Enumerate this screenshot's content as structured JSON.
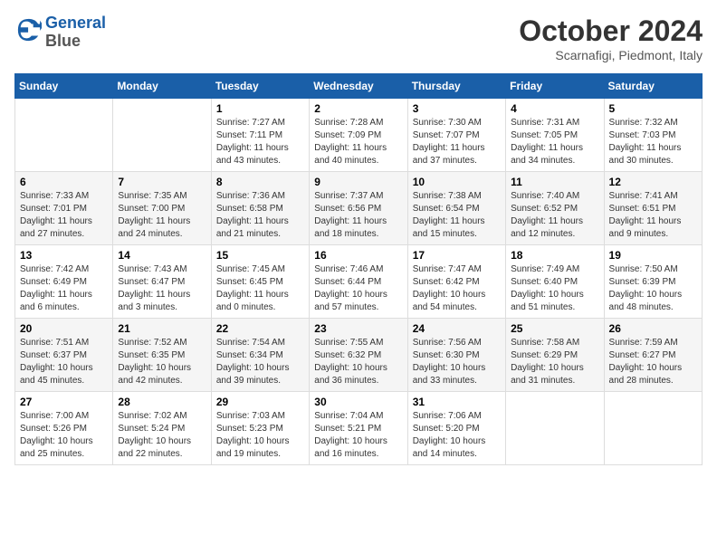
{
  "header": {
    "logo_line1": "General",
    "logo_line2": "Blue",
    "month": "October 2024",
    "location": "Scarnafigi, Piedmont, Italy"
  },
  "days_of_week": [
    "Sunday",
    "Monday",
    "Tuesday",
    "Wednesday",
    "Thursday",
    "Friday",
    "Saturday"
  ],
  "weeks": [
    [
      {
        "day": "",
        "sunrise": "",
        "sunset": "",
        "daylight": ""
      },
      {
        "day": "",
        "sunrise": "",
        "sunset": "",
        "daylight": ""
      },
      {
        "day": "1",
        "sunrise": "Sunrise: 7:27 AM",
        "sunset": "Sunset: 7:11 PM",
        "daylight": "Daylight: 11 hours and 43 minutes."
      },
      {
        "day": "2",
        "sunrise": "Sunrise: 7:28 AM",
        "sunset": "Sunset: 7:09 PM",
        "daylight": "Daylight: 11 hours and 40 minutes."
      },
      {
        "day": "3",
        "sunrise": "Sunrise: 7:30 AM",
        "sunset": "Sunset: 7:07 PM",
        "daylight": "Daylight: 11 hours and 37 minutes."
      },
      {
        "day": "4",
        "sunrise": "Sunrise: 7:31 AM",
        "sunset": "Sunset: 7:05 PM",
        "daylight": "Daylight: 11 hours and 34 minutes."
      },
      {
        "day": "5",
        "sunrise": "Sunrise: 7:32 AM",
        "sunset": "Sunset: 7:03 PM",
        "daylight": "Daylight: 11 hours and 30 minutes."
      }
    ],
    [
      {
        "day": "6",
        "sunrise": "Sunrise: 7:33 AM",
        "sunset": "Sunset: 7:01 PM",
        "daylight": "Daylight: 11 hours and 27 minutes."
      },
      {
        "day": "7",
        "sunrise": "Sunrise: 7:35 AM",
        "sunset": "Sunset: 7:00 PM",
        "daylight": "Daylight: 11 hours and 24 minutes."
      },
      {
        "day": "8",
        "sunrise": "Sunrise: 7:36 AM",
        "sunset": "Sunset: 6:58 PM",
        "daylight": "Daylight: 11 hours and 21 minutes."
      },
      {
        "day": "9",
        "sunrise": "Sunrise: 7:37 AM",
        "sunset": "Sunset: 6:56 PM",
        "daylight": "Daylight: 11 hours and 18 minutes."
      },
      {
        "day": "10",
        "sunrise": "Sunrise: 7:38 AM",
        "sunset": "Sunset: 6:54 PM",
        "daylight": "Daylight: 11 hours and 15 minutes."
      },
      {
        "day": "11",
        "sunrise": "Sunrise: 7:40 AM",
        "sunset": "Sunset: 6:52 PM",
        "daylight": "Daylight: 11 hours and 12 minutes."
      },
      {
        "day": "12",
        "sunrise": "Sunrise: 7:41 AM",
        "sunset": "Sunset: 6:51 PM",
        "daylight": "Daylight: 11 hours and 9 minutes."
      }
    ],
    [
      {
        "day": "13",
        "sunrise": "Sunrise: 7:42 AM",
        "sunset": "Sunset: 6:49 PM",
        "daylight": "Daylight: 11 hours and 6 minutes."
      },
      {
        "day": "14",
        "sunrise": "Sunrise: 7:43 AM",
        "sunset": "Sunset: 6:47 PM",
        "daylight": "Daylight: 11 hours and 3 minutes."
      },
      {
        "day": "15",
        "sunrise": "Sunrise: 7:45 AM",
        "sunset": "Sunset: 6:45 PM",
        "daylight": "Daylight: 11 hours and 0 minutes."
      },
      {
        "day": "16",
        "sunrise": "Sunrise: 7:46 AM",
        "sunset": "Sunset: 6:44 PM",
        "daylight": "Daylight: 10 hours and 57 minutes."
      },
      {
        "day": "17",
        "sunrise": "Sunrise: 7:47 AM",
        "sunset": "Sunset: 6:42 PM",
        "daylight": "Daylight: 10 hours and 54 minutes."
      },
      {
        "day": "18",
        "sunrise": "Sunrise: 7:49 AM",
        "sunset": "Sunset: 6:40 PM",
        "daylight": "Daylight: 10 hours and 51 minutes."
      },
      {
        "day": "19",
        "sunrise": "Sunrise: 7:50 AM",
        "sunset": "Sunset: 6:39 PM",
        "daylight": "Daylight: 10 hours and 48 minutes."
      }
    ],
    [
      {
        "day": "20",
        "sunrise": "Sunrise: 7:51 AM",
        "sunset": "Sunset: 6:37 PM",
        "daylight": "Daylight: 10 hours and 45 minutes."
      },
      {
        "day": "21",
        "sunrise": "Sunrise: 7:52 AM",
        "sunset": "Sunset: 6:35 PM",
        "daylight": "Daylight: 10 hours and 42 minutes."
      },
      {
        "day": "22",
        "sunrise": "Sunrise: 7:54 AM",
        "sunset": "Sunset: 6:34 PM",
        "daylight": "Daylight: 10 hours and 39 minutes."
      },
      {
        "day": "23",
        "sunrise": "Sunrise: 7:55 AM",
        "sunset": "Sunset: 6:32 PM",
        "daylight": "Daylight: 10 hours and 36 minutes."
      },
      {
        "day": "24",
        "sunrise": "Sunrise: 7:56 AM",
        "sunset": "Sunset: 6:30 PM",
        "daylight": "Daylight: 10 hours and 33 minutes."
      },
      {
        "day": "25",
        "sunrise": "Sunrise: 7:58 AM",
        "sunset": "Sunset: 6:29 PM",
        "daylight": "Daylight: 10 hours and 31 minutes."
      },
      {
        "day": "26",
        "sunrise": "Sunrise: 7:59 AM",
        "sunset": "Sunset: 6:27 PM",
        "daylight": "Daylight: 10 hours and 28 minutes."
      }
    ],
    [
      {
        "day": "27",
        "sunrise": "Sunrise: 7:00 AM",
        "sunset": "Sunset: 5:26 PM",
        "daylight": "Daylight: 10 hours and 25 minutes."
      },
      {
        "day": "28",
        "sunrise": "Sunrise: 7:02 AM",
        "sunset": "Sunset: 5:24 PM",
        "daylight": "Daylight: 10 hours and 22 minutes."
      },
      {
        "day": "29",
        "sunrise": "Sunrise: 7:03 AM",
        "sunset": "Sunset: 5:23 PM",
        "daylight": "Daylight: 10 hours and 19 minutes."
      },
      {
        "day": "30",
        "sunrise": "Sunrise: 7:04 AM",
        "sunset": "Sunset: 5:21 PM",
        "daylight": "Daylight: 10 hours and 16 minutes."
      },
      {
        "day": "31",
        "sunrise": "Sunrise: 7:06 AM",
        "sunset": "Sunset: 5:20 PM",
        "daylight": "Daylight: 10 hours and 14 minutes."
      },
      {
        "day": "",
        "sunrise": "",
        "sunset": "",
        "daylight": ""
      },
      {
        "day": "",
        "sunrise": "",
        "sunset": "",
        "daylight": ""
      }
    ]
  ]
}
